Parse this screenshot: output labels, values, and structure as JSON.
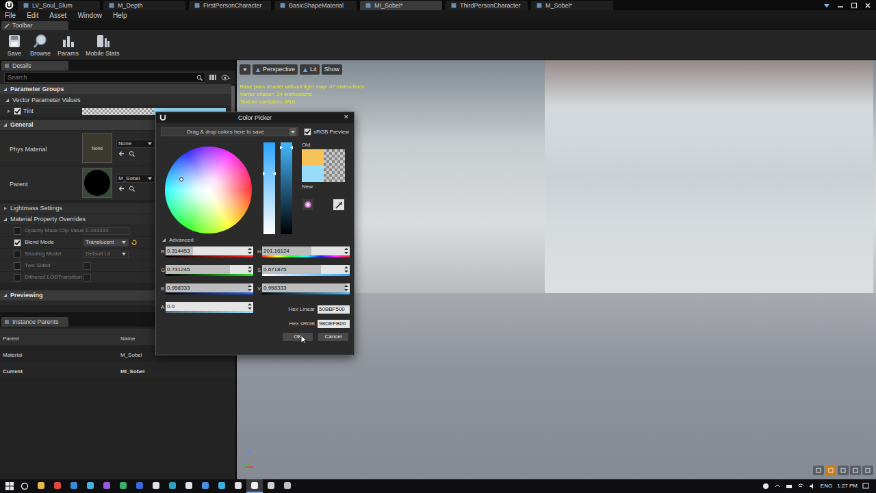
{
  "window_tabs": [
    {
      "label": "LV_Soul_Slum",
      "selected": false
    },
    {
      "label": "M_Depth",
      "selected": false
    },
    {
      "label": "FirstPersonCharacter",
      "selected": false
    },
    {
      "label": "BasicShapeMaterial",
      "selected": false
    },
    {
      "label": "MI_Sobel*",
      "selected": true
    },
    {
      "label": "ThirdPersonCharacter",
      "selected": false
    },
    {
      "label": "M_Sobel*",
      "selected": false
    }
  ],
  "menu": [
    "File",
    "Edit",
    "Asset",
    "Window",
    "Help"
  ],
  "toolbar": {
    "tab": "Toolbar",
    "buttons": [
      "Save",
      "Browse",
      "Params",
      "Mobile Stats"
    ]
  },
  "details": {
    "tab": "Details",
    "search": {
      "placeholder": "Search"
    },
    "parameter_groups": {
      "title": "Parameter Groups",
      "expanded": true,
      "group": {
        "title": "Vector Parameter Values",
        "expanded": true
      },
      "params": [
        {
          "name": "Tint",
          "checked": true,
          "expanded": false
        }
      ]
    },
    "general": {
      "title": "General",
      "expanded": true,
      "phys_material": {
        "label": "Phys Material",
        "thumbnail": "None",
        "value": "None"
      },
      "parent": {
        "label": "Parent",
        "value": "M_Sobel"
      }
    },
    "lightmass": {
      "title": "Lightmass Settings",
      "expanded": false
    },
    "overrides": {
      "title": "Material Property Overrides",
      "expanded": true,
      "rows": [
        {
          "label": "Opacity Mask Clip Value",
          "checked": false,
          "disabled": true,
          "kind": "number",
          "value": "0.333333"
        },
        {
          "label": "Blend Mode",
          "checked": true,
          "disabled": false,
          "kind": "dropdown",
          "value": "Translucent"
        },
        {
          "label": "Shading Model",
          "checked": false,
          "disabled": true,
          "kind": "dropdown",
          "value": "Default Lit"
        },
        {
          "label": "Two Sided",
          "checked": false,
          "disabled": true,
          "kind": "checkbox",
          "value_checked": false
        },
        {
          "label": "Dithered LODTransition",
          "checked": false,
          "disabled": true,
          "kind": "checkbox",
          "value_checked": false
        }
      ]
    },
    "previewing": {
      "title": "Previewing",
      "expanded": true
    }
  },
  "instance_parents": {
    "tab": "Instance Parents",
    "columns": [
      "Parent",
      "Name"
    ],
    "rows": [
      {
        "cells": [
          "Material",
          "M_Sobel"
        ],
        "selected": false
      },
      {
        "cells": [
          "Current",
          "MI_Sobel"
        ],
        "selected": true
      }
    ]
  },
  "viewport": {
    "buttons": [
      {
        "label": "Perspective"
      },
      {
        "label": "Lit"
      },
      {
        "label": "Show"
      }
    ],
    "stats": [
      "Base pass shader without light map: 47 instructions",
      "Vertex shader: 24 instructions",
      "Texture samplers: 3/16"
    ],
    "axis": "Z"
  },
  "color_picker": {
    "title": "Color Picker",
    "close": "×",
    "saved_colors": "Drag & drop colors here to save",
    "srgb_preview": {
      "label": "sRGB Preview",
      "checked": true
    },
    "old_label": "Old",
    "new_label": "New",
    "old_color": "#F7C257",
    "new_color": "#98DEFB",
    "advanced": {
      "label": "Advanced",
      "expanded": true
    },
    "rgba": [
      {
        "name": "R",
        "value": "0.314453",
        "level": 0.314453,
        "kind": "red"
      },
      {
        "name": "G",
        "value": "0.731245",
        "level": 0.731245,
        "kind": "green"
      },
      {
        "name": "B",
        "value": "0.958333",
        "level": 0.958333,
        "kind": "blue"
      },
      {
        "name": "A",
        "value": "0.0",
        "level": 0.0,
        "kind": "alpha"
      }
    ],
    "hsv": [
      {
        "name": "H",
        "value": "201.16124",
        "level": 0.5588,
        "kind": "hue"
      },
      {
        "name": "S",
        "value": "0.671875",
        "level": 0.671875,
        "kind": "saturation"
      },
      {
        "name": "V",
        "value": "0.958333",
        "level": 0.958333,
        "kind": "value"
      }
    ],
    "hex": [
      {
        "label": "Hex Linear",
        "value": "50BBF500"
      },
      {
        "label": "Hex sRGB",
        "value": "98DEFB00"
      }
    ],
    "buttons": [
      "OK",
      "Cancel"
    ]
  },
  "taskbar": {
    "apps": [
      {
        "selected": false
      },
      {
        "selected": false
      },
      {
        "selected": false
      },
      {
        "selected": false
      },
      {
        "selected": false
      },
      {
        "selected": false
      },
      {
        "selected": false
      },
      {
        "selected": false
      },
      {
        "selected": false
      },
      {
        "selected": false
      },
      {
        "selected": false
      },
      {
        "selected": false
      },
      {
        "selected": false
      },
      {
        "selected": true
      },
      {
        "selected": false
      },
      {
        "selected": false
      }
    ],
    "language": "ENG",
    "time": "1:27 PM"
  }
}
